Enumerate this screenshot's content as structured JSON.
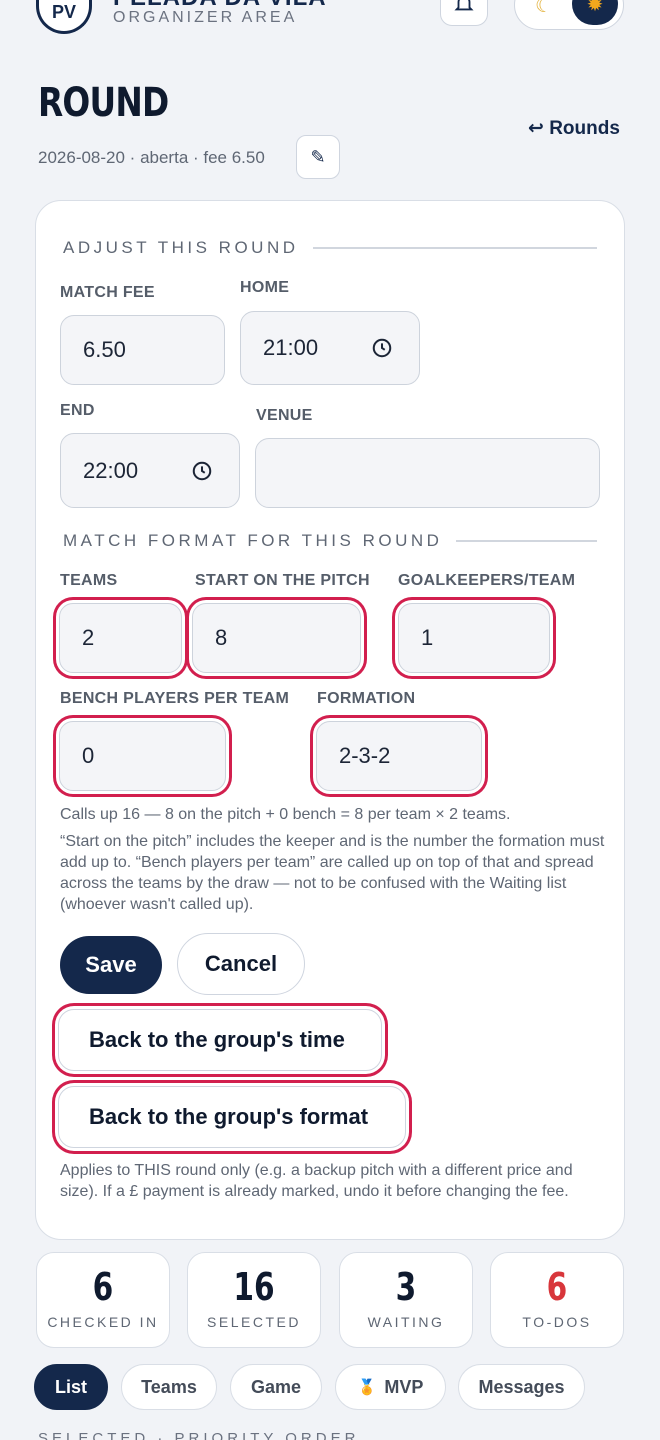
{
  "header": {
    "org_initials": "PV",
    "org_name": "PELADA DA VILA",
    "org_subtitle": "ORGANIZER AREA",
    "theme_moon": "☾",
    "theme_sun": "✹"
  },
  "page": {
    "title": "ROUND",
    "back_link": "↩ Rounds",
    "meta": "2026-08-20 · aberta · fee 6.50",
    "edit_icon": "✎"
  },
  "adjust": {
    "section_title": "ADJUST THIS ROUND",
    "match_fee_label": "MATCH FEE",
    "match_fee_value": "6.50",
    "home_label": "HOME",
    "home_value": "21:00",
    "end_label": "END",
    "end_value": "22:00",
    "venue_label": "VENUE",
    "venue_value": ""
  },
  "format": {
    "section_title": "MATCH FORMAT FOR THIS ROUND",
    "teams_label": "TEAMS",
    "teams_value": "2",
    "start_label": "START ON THE PITCH",
    "start_value": "8",
    "gk_label": "GOALKEEPERS/TEAM",
    "gk_value": "1",
    "bench_label": "BENCH PLAYERS PER TEAM",
    "bench_value": "0",
    "formation_label": "FORMATION",
    "formation_value": "2-3-2",
    "calc_note": "Calls up 16 — 8 on the pitch + 0 bench = 8 per team × 2 teams.",
    "explain_note": "“Start on the pitch” includes the keeper and is the number the formation must add up to. “Bench players per team” are called up on top of that and spread across the teams by the draw — not to be confused with the Waiting list (whoever wasn't called up)."
  },
  "actions": {
    "save": "Save",
    "cancel": "Cancel",
    "back_time": "Back to the group's time",
    "back_format": "Back to the group's format",
    "footer_note": "Applies to THIS round only (e.g. a backup pitch with a different price and size). If a £ payment is already marked, undo it before changing the fee."
  },
  "stats": [
    {
      "value": "6",
      "label": "CHECKED IN"
    },
    {
      "value": "16",
      "label": "SELECTED"
    },
    {
      "value": "3",
      "label": "WAITING"
    },
    {
      "value": "6",
      "label": "TO-DOS",
      "color": "#d8363b"
    }
  ],
  "tabs": [
    {
      "label": "List",
      "active": true
    },
    {
      "label": "Teams"
    },
    {
      "label": "Game"
    },
    {
      "label": "MVP",
      "icon": "🏅"
    },
    {
      "label": "Messages"
    }
  ],
  "bottom_section": "SELECTED · PRIORITY ORDER",
  "colors": {
    "navy": "#14284b",
    "highlight": "#d21f4e",
    "danger": "#d8363b"
  }
}
